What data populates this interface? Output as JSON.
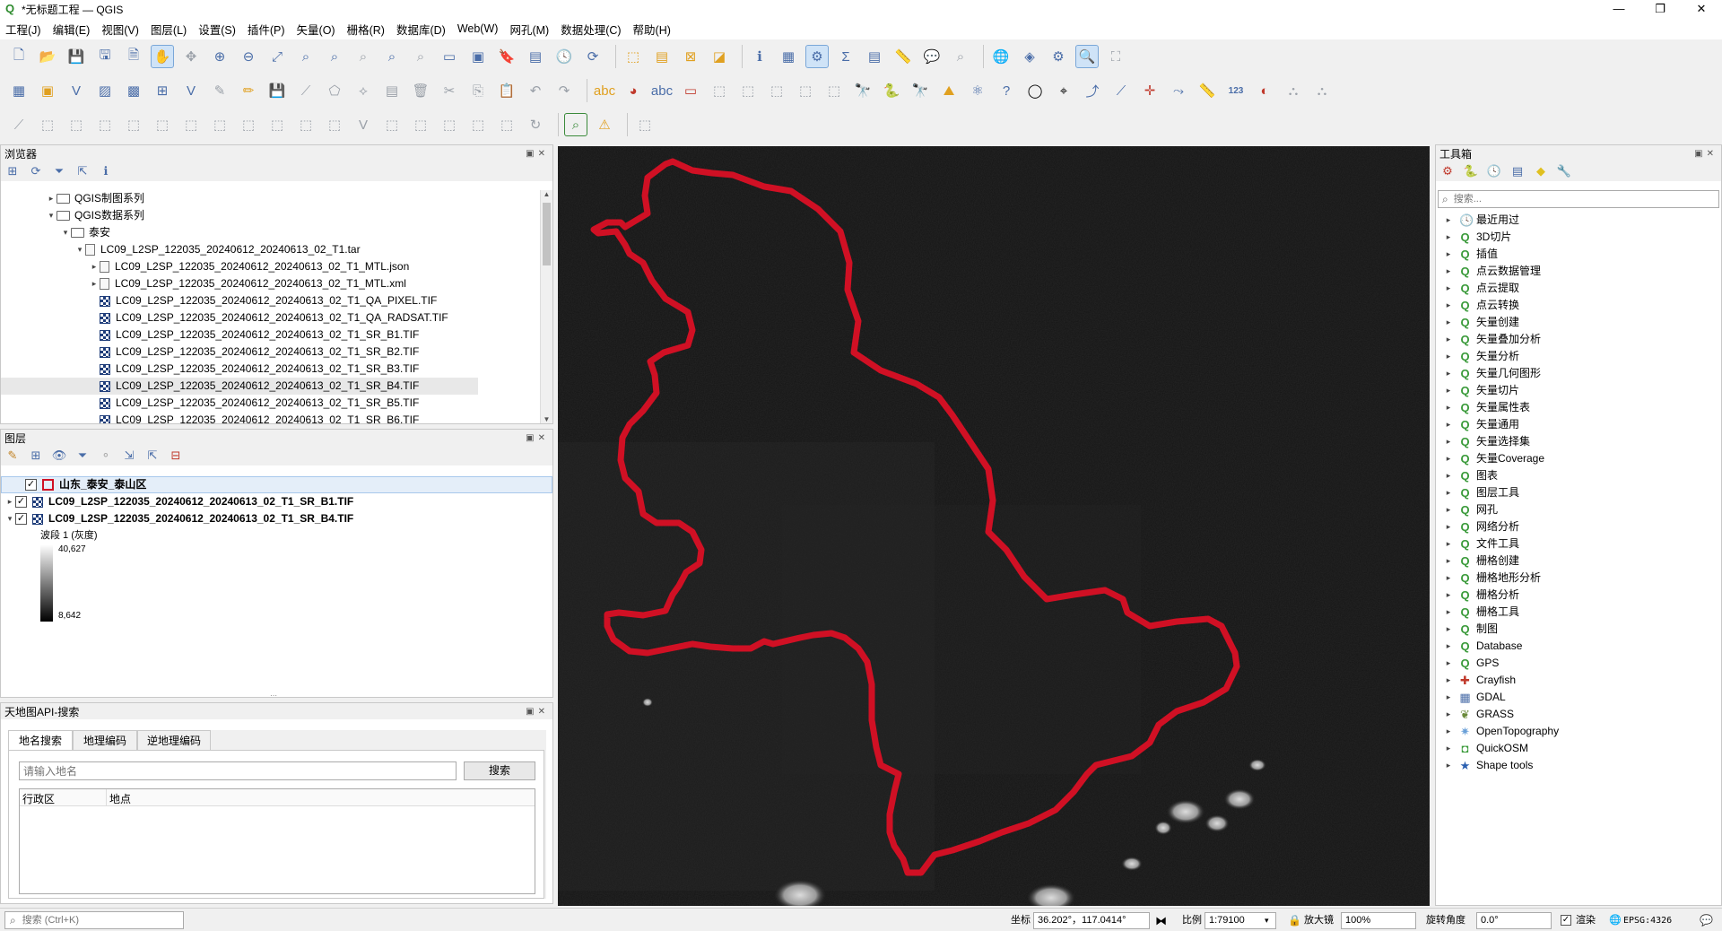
{
  "window": {
    "title": "*无标题工程 — QGIS",
    "controls": [
      "—",
      "❐",
      "✕"
    ]
  },
  "menu": [
    "工程(J)",
    "编辑(E)",
    "视图(V)",
    "图层(L)",
    "设置(S)",
    "插件(P)",
    "矢量(O)",
    "栅格(R)",
    "数据库(D)",
    "Web(W)",
    "网孔(M)",
    "数据处理(C)",
    "帮助(H)"
  ],
  "browser": {
    "title": "浏览器",
    "items": [
      {
        "label": "QGIS制图系列",
        "expand": "▸",
        "icon": "folder-icon"
      },
      {
        "label": "QGIS数据系列",
        "expand": "▾",
        "icon": "folder-icon"
      },
      {
        "label": "泰安",
        "expand": "▾",
        "icon": "folder-icon"
      },
      {
        "label": "LC09_L2SP_122035_20240612_20240613_02_T1.tar",
        "expand": "▾",
        "icon": "file-icon"
      },
      {
        "label": "LC09_L2SP_122035_20240612_20240613_02_T1_MTL.json",
        "expand": "▸",
        "icon": "file-icon"
      },
      {
        "label": "LC09_L2SP_122035_20240612_20240613_02_T1_MTL.xml",
        "expand": "▸",
        "icon": "file-icon"
      },
      {
        "label": "LC09_L2SP_122035_20240612_20240613_02_T1_QA_PIXEL.TIF",
        "expand": "",
        "icon": "raster-icon"
      },
      {
        "label": "LC09_L2SP_122035_20240612_20240613_02_T1_QA_RADSAT.TIF",
        "expand": "",
        "icon": "raster-icon"
      },
      {
        "label": "LC09_L2SP_122035_20240612_20240613_02_T1_SR_B1.TIF",
        "expand": "",
        "icon": "raster-icon"
      },
      {
        "label": "LC09_L2SP_122035_20240612_20240613_02_T1_SR_B2.TIF",
        "expand": "",
        "icon": "raster-icon"
      },
      {
        "label": "LC09_L2SP_122035_20240612_20240613_02_T1_SR_B3.TIF",
        "expand": "",
        "icon": "raster-icon"
      },
      {
        "label": "LC09_L2SP_122035_20240612_20240613_02_T1_SR_B4.TIF",
        "expand": "",
        "icon": "raster-icon"
      },
      {
        "label": "LC09_L2SP_122035_20240612_20240613_02_T1_SR_B5.TIF",
        "expand": "",
        "icon": "raster-icon"
      },
      {
        "label": "LC09_L2SP_122035_20240612_20240613_02_T1_SR_B6.TIF",
        "expand": "",
        "icon": "raster-icon"
      }
    ]
  },
  "layers": {
    "title": "图层",
    "items": [
      {
        "label": "山东_泰安_泰山区",
        "expand": "",
        "checked": "✓",
        "icon": "polygon-icon"
      },
      {
        "label": "LC09_L2SP_122035_20240612_20240613_02_T1_SR_B1.TIF",
        "expand": "▸",
        "checked": "✓",
        "icon": "raster-icon"
      },
      {
        "label": "LC09_L2SP_122035_20240612_20240613_02_T1_SR_B4.TIF",
        "expand": "▾",
        "checked": "✓",
        "icon": "raster-icon"
      }
    ],
    "legend": {
      "band": "波段 1 (灰度)",
      "max": "40,627",
      "min": "8,642"
    }
  },
  "tianditu": {
    "title": "天地图API-搜索",
    "tabs": [
      "地名搜索",
      "地理编码",
      "逆地理编码"
    ],
    "search_placeholder": "请输入地名",
    "search_button": "搜索",
    "columns": [
      "行政区",
      "地点"
    ]
  },
  "toolbox": {
    "title": "工具箱",
    "search_placeholder": "搜索...",
    "items": [
      {
        "label": "最近用过",
        "icon": "clock-icon"
      },
      {
        "label": "3D切片",
        "icon": "qgis-icon"
      },
      {
        "label": "插值",
        "icon": "qgis-icon"
      },
      {
        "label": "点云数据管理",
        "icon": "qgis-icon"
      },
      {
        "label": "点云提取",
        "icon": "qgis-icon"
      },
      {
        "label": "点云转换",
        "icon": "qgis-icon"
      },
      {
        "label": "矢量创建",
        "icon": "qgis-icon"
      },
      {
        "label": "矢量叠加分析",
        "icon": "qgis-icon"
      },
      {
        "label": "矢量分析",
        "icon": "qgis-icon"
      },
      {
        "label": "矢量几何图形",
        "icon": "qgis-icon"
      },
      {
        "label": "矢量切片",
        "icon": "qgis-icon"
      },
      {
        "label": "矢量属性表",
        "icon": "qgis-icon"
      },
      {
        "label": "矢量通用",
        "icon": "qgis-icon"
      },
      {
        "label": "矢量选择集",
        "icon": "qgis-icon"
      },
      {
        "label": "矢量Coverage",
        "icon": "qgis-icon"
      },
      {
        "label": "图表",
        "icon": "qgis-icon"
      },
      {
        "label": "图层工具",
        "icon": "qgis-icon"
      },
      {
        "label": "网孔",
        "icon": "qgis-icon"
      },
      {
        "label": "网络分析",
        "icon": "qgis-icon"
      },
      {
        "label": "文件工具",
        "icon": "qgis-icon"
      },
      {
        "label": "栅格创建",
        "icon": "qgis-icon"
      },
      {
        "label": "栅格地形分析",
        "icon": "qgis-icon"
      },
      {
        "label": "栅格分析",
        "icon": "qgis-icon"
      },
      {
        "label": "栅格工具",
        "icon": "qgis-icon"
      },
      {
        "label": "制图",
        "icon": "qgis-icon"
      },
      {
        "label": "Database",
        "icon": "qgis-icon"
      },
      {
        "label": "GPS",
        "icon": "qgis-icon"
      },
      {
        "label": "Crayfish",
        "icon": "crayfish-icon"
      },
      {
        "label": "GDAL",
        "icon": "gdal-icon"
      },
      {
        "label": "GRASS",
        "icon": "grass-icon"
      },
      {
        "label": "OpenTopography",
        "icon": "opentopography-icon"
      },
      {
        "label": "QuickOSM",
        "icon": "quickosm-icon"
      },
      {
        "label": "Shape tools",
        "icon": "star-icon"
      }
    ]
  },
  "status": {
    "search_placeholder": "搜索 (Ctrl+K)",
    "coord_label": "坐标",
    "coord_value": "36.202°，117.0414°",
    "scale_label": "比例",
    "scale_value": "1:79100",
    "magnifier_label": "放大镜",
    "magnifier_value": "100%",
    "rotation_label": "旋转角度",
    "rotation_value": "0.0°",
    "render_label": "渲染",
    "crs": "EPSG:4326"
  },
  "colors": {
    "boundary": "#d01024",
    "map_bg": "#141414",
    "accent": "#2e8b2e"
  }
}
